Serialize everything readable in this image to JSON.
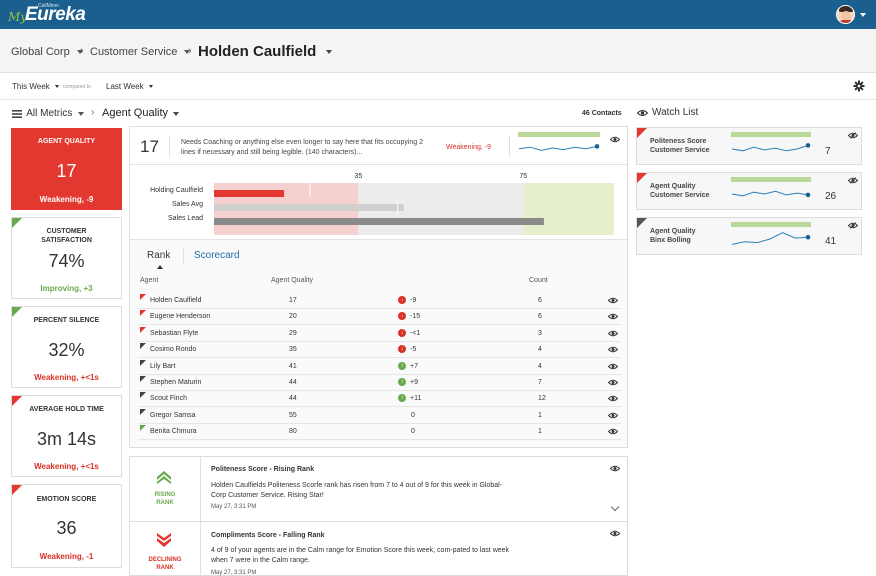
{
  "app": {
    "logo_my": "My",
    "logo_name": "Eureka",
    "logo_brand": "CallMiner"
  },
  "breadcrumb": {
    "org": "Global Corp",
    "group": "Customer Service",
    "agent": "Holden Caulfield"
  },
  "filters": {
    "period": "This Week",
    "compared_label": "compared to",
    "compare": "Last Week"
  },
  "metrics_bar": {
    "all_metrics": "All Metrics",
    "current": "Agent Quality",
    "contacts": "46 Contacts"
  },
  "tiles": [
    {
      "label": "AGENT QUALITY",
      "value": "17",
      "trend": "Weakening, -9",
      "status": "red"
    },
    {
      "label": "CUSTOMER SATISFACTION",
      "value": "74%",
      "trend": "Improving, +3",
      "status": "green"
    },
    {
      "label": "PERCENT SILENCE",
      "value": "32%",
      "trend": "Weakening, +<1s",
      "status": "green"
    },
    {
      "label": "AVERAGE HOLD TIME",
      "value": "3m 14s",
      "trend": "Weakening, +<1s",
      "status": "red"
    },
    {
      "label": "EMOTION SCORE",
      "value": "36",
      "trend": "Weakening, -1",
      "status": "red"
    }
  ],
  "detail": {
    "value": "17",
    "description": "Needs Coaching or anything else even longer to say here that fits occupying 2 lines if necessary and still being legible. (140 characters)...",
    "trend": "Weakening, -9",
    "sparkline": [
      0.45,
      0.55,
      0.35,
      0.5,
      0.4,
      0.55,
      0.45,
      0.6
    ]
  },
  "comparison": {
    "threshold_low_label": "35",
    "threshold_high_label": "75",
    "threshold_low": 35,
    "threshold_high": 75,
    "scale_max": 97,
    "rows": [
      {
        "label": "Holding Caulfield",
        "value": 17
      },
      {
        "label": "Sales Avg",
        "value": 46
      },
      {
        "label": "Sales Lead",
        "value": 80
      }
    ]
  },
  "tabs": {
    "rank": "Rank",
    "scorecard": "Scorecard"
  },
  "table": {
    "headers": {
      "agent": "Agent",
      "metric": "Agent Quality",
      "count": "Count"
    },
    "rows": [
      {
        "agent": "Holden Caulfield",
        "score": "17",
        "change": "-9",
        "dir": "down",
        "count": "6",
        "flag": "red"
      },
      {
        "agent": "Eugene Henderson",
        "score": "20",
        "change": "-15",
        "dir": "down",
        "count": "6",
        "flag": "red"
      },
      {
        "agent": "Sebastian Flyte",
        "score": "29",
        "change": "-<1",
        "dir": "down",
        "count": "3",
        "flag": "red"
      },
      {
        "agent": "Cosimo Rondo",
        "score": "35",
        "change": "-5",
        "dir": "down",
        "count": "4",
        "flag": "dark"
      },
      {
        "agent": "Lily Bart",
        "score": "41",
        "change": "+7",
        "dir": "up",
        "count": "4",
        "flag": "dark"
      },
      {
        "agent": "Stephen Maturin",
        "score": "44",
        "change": "+9",
        "dir": "up",
        "count": "7",
        "flag": "dark"
      },
      {
        "agent": "Scout Finch",
        "score": "44",
        "change": "+11",
        "dir": "up",
        "count": "12",
        "flag": "dark"
      },
      {
        "agent": "Gregor Samsa",
        "score": "55",
        "change": "0",
        "dir": "none",
        "count": "1",
        "flag": "dark"
      },
      {
        "agent": "Benita Chmura",
        "score": "80",
        "change": "0",
        "dir": "none",
        "count": "1",
        "flag": "green"
      }
    ]
  },
  "notifications": [
    {
      "side_label_1": "RISING",
      "side_label_2": "RANK",
      "title": "Politeness Score - Rising Rank",
      "text": "Holden Caulfields Politeness Scorfe rank has risen from 7 to 4 out of 9 for this week in Global-Corp Customer Service. Rising Star!",
      "date": "May 27, 3:31 PM"
    },
    {
      "side_label_1": "DECLINING",
      "side_label_2": "RANK",
      "title": "Compliments Score - Falling Rank",
      "text": "4 of 9 of your agents are in the Calm range for Emotion Score this week, com-pated to last week when 7 were in the Calm range.",
      "date": "May 27, 3:31 PM"
    }
  ],
  "watchlist": {
    "title": "Watch List",
    "items": [
      {
        "line1": "Politeness Score",
        "line2": "Customer Service",
        "value": "7",
        "flag": "red",
        "spark": [
          0.5,
          0.4,
          0.6,
          0.45,
          0.55,
          0.4,
          0.5,
          0.7
        ]
      },
      {
        "line1": "Agent Quality",
        "line2": "Customer Service",
        "value": "26",
        "flag": "red",
        "spark": [
          0.5,
          0.4,
          0.6,
          0.5,
          0.65,
          0.45,
          0.55,
          0.45
        ]
      },
      {
        "line1": "Agent Quality",
        "line2": "Binx Bolling",
        "value": "41",
        "flag": "dark",
        "spark": [
          0.2,
          0.35,
          0.3,
          0.5,
          0.85,
          0.55,
          0.6
        ]
      }
    ]
  },
  "colors": {
    "topbar": "#1b5f8f",
    "alert_red": "#e2382f",
    "good_green": "#6aa84f",
    "link_blue": "#1f6fa8",
    "spark_blue": "#2e7fb8",
    "band_green": "#b9d89a"
  }
}
